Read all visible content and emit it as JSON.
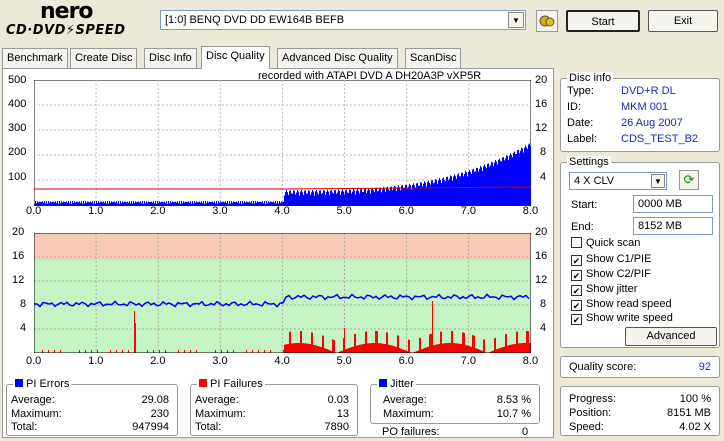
{
  "logo": {
    "top": "nero",
    "bottom": "CD·DVD⚡SPEED"
  },
  "toolbar": {
    "drive": "[1:0]  BENQ DVD DD EW164B BEFB",
    "start": "Start",
    "exit": "Exit"
  },
  "tabs": [
    "Benchmark",
    "Create Disc",
    "Disc Info",
    "Disc Quality",
    "Advanced Disc Quality",
    "ScanDisc"
  ],
  "recorded": "recorded with ATAPI   DVD  A   DH20A3P    vXP5R",
  "chart_data": [
    {
      "type": "bar",
      "x_ticks": [
        "0.0",
        "1.0",
        "2.0",
        "3.0",
        "4.0",
        "5.0",
        "6.0",
        "7.0",
        "8.0"
      ],
      "y_left_ticks": [
        "500",
        "400",
        "300",
        "200",
        "100"
      ],
      "y_right_ticks": [
        "20",
        "16",
        "12",
        "8",
        "4"
      ],
      "series": [
        {
          "name": "PI Errors",
          "color": "#0000ff"
        },
        {
          "name": "read speed",
          "color": "#d00000"
        }
      ]
    },
    {
      "type": "bar",
      "x_ticks": [
        "0.0",
        "1.0",
        "2.0",
        "3.0",
        "4.0",
        "5.0",
        "6.0",
        "7.0",
        "8.0"
      ],
      "y_left_ticks": [
        "20",
        "16",
        "12",
        "8",
        "4"
      ],
      "y_right_ticks": [
        "20",
        "16",
        "12",
        "8",
        "4"
      ],
      "series": [
        {
          "name": "PI Failures",
          "color": "#ff0000"
        },
        {
          "name": "Jitter",
          "color": "#0000ff"
        }
      ]
    }
  ],
  "disc_info": {
    "title": "Disc info",
    "type_l": "Type:",
    "type": "DVD+R DL",
    "id_l": "ID:",
    "id": "MKM 001",
    "date_l": "Date:",
    "date": "26 Aug 2007",
    "label_l": "Label:",
    "label": "CDS_TEST_B2"
  },
  "settings": {
    "title": "Settings",
    "speed": "4 X CLV",
    "start_l": "Start:",
    "start": "0000 MB",
    "end_l": "End:",
    "end": "8152 MB",
    "quick": "Quick scan",
    "c1": "Show C1/PIE",
    "c2": "Show C2/PIF",
    "jitter": "Show jitter",
    "read": "Show read speed",
    "write": "Show write speed",
    "advanced": "Advanced"
  },
  "quality": {
    "label": "Quality score:",
    "value": "92"
  },
  "pi_errors": {
    "title": "PI Errors",
    "avg_l": "Average:",
    "avg": "29.08",
    "max_l": "Maximum:",
    "max": "230",
    "tot_l": "Total:",
    "tot": "947994"
  },
  "pi_failures": {
    "title": "PI Failures",
    "avg_l": "Average:",
    "avg": "0.03",
    "max_l": "Maximum:",
    "max": "13",
    "tot_l": "Total:",
    "tot": "7890"
  },
  "jitter": {
    "title": "Jitter",
    "avg_l": "Average:",
    "avg": "8.53 %",
    "max_l": "Maximum:",
    "max": "10.7 %",
    "po_l": "PO failures:",
    "po": "0"
  },
  "progress": {
    "prog_l": "Progress:",
    "prog": "100 %",
    "pos_l": "Position:",
    "pos": "8151 MB",
    "spd_l": "Speed:",
    "spd": "4.02 X"
  }
}
